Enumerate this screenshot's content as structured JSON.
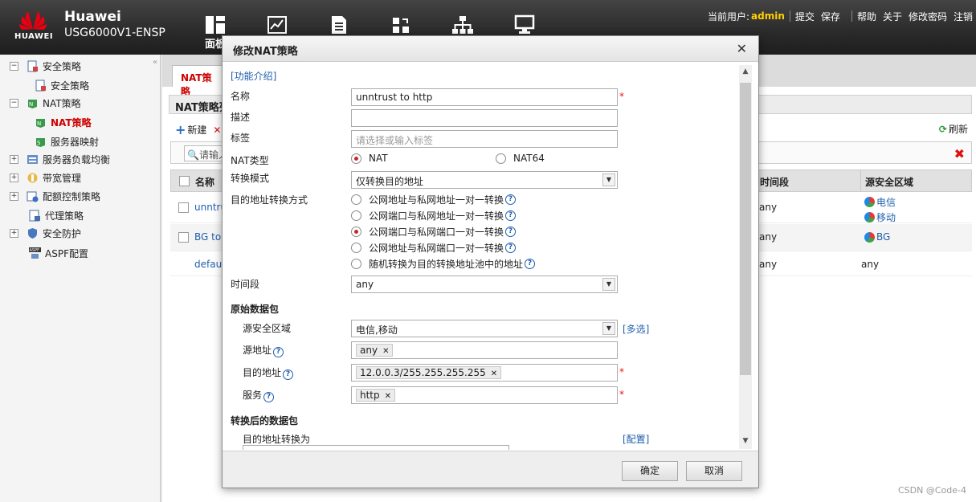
{
  "header": {
    "logo_text": "HUAWEI",
    "brand": "Huawei",
    "model": "USG6000V1-ENSP",
    "nav_label": "面板",
    "current_user_label": "当前用户:",
    "current_user": "admin",
    "links": [
      "提交",
      "保存",
      "帮助",
      "关于",
      "修改密码",
      "注销"
    ]
  },
  "sidebar": {
    "items": [
      {
        "label": "安全策略",
        "expander": "−",
        "icon": "security-policy-icon"
      },
      {
        "label": "安全策略",
        "icon": "security-policy-leaf-icon"
      },
      {
        "label": "NAT策略",
        "expander": "−",
        "icon": "nat-policy-icon"
      },
      {
        "label": "NAT策略",
        "icon": "nat-policy-leaf-icon",
        "active": true
      },
      {
        "label": "服务器映射",
        "icon": "server-mapping-icon"
      },
      {
        "label": "服务器负载均衡",
        "expander": "+",
        "icon": "load-balance-icon"
      },
      {
        "label": "带宽管理",
        "expander": "+",
        "icon": "bandwidth-icon"
      },
      {
        "label": "配额控制策略",
        "expander": "+",
        "icon": "quota-icon"
      },
      {
        "label": "代理策略",
        "icon": "proxy-icon"
      },
      {
        "label": "安全防护",
        "expander": "+",
        "icon": "shield-icon"
      },
      {
        "label": "ASPF配置",
        "icon": "aspf-icon"
      }
    ]
  },
  "main": {
    "tab": "NAT策略",
    "panel_title": "NAT策略列",
    "new_label": "新建",
    "refresh_label": "刷新",
    "search_placeholder": "请输入",
    "columns": {
      "name": "名称",
      "time": "时间段",
      "src_zone": "源安全区域"
    },
    "rows": [
      {
        "name": "unntru",
        "time": "any",
        "zones": [
          "电信",
          "移动"
        ]
      },
      {
        "name": "BG to",
        "time": "any",
        "zones": [
          "BG"
        ]
      },
      {
        "name": "default",
        "time": "any",
        "zones_text": "any"
      }
    ]
  },
  "dialog": {
    "title": "修改NAT策略",
    "help_link": "[功能介绍]",
    "name_label": "名称",
    "name_value": "unntrust to http",
    "desc_label": "描述",
    "desc_value": "",
    "tag_label": "标签",
    "tag_placeholder": "请选择或输入标签",
    "nat_type_label": "NAT类型",
    "nat_type_options": [
      "NAT",
      "NAT64"
    ],
    "nat_type_selected": "NAT",
    "mode_label": "转换模式",
    "mode_value": "仅转换目的地址",
    "dst_method_label": "目的地址转换方式",
    "dst_methods": [
      "公网地址与私网地址一对一转换",
      "公网端口与私网地址一对一转换",
      "公网端口与私网端口一对一转换",
      "公网地址与私网端口一对一转换",
      "随机转换为目的转换地址池中的地址"
    ],
    "dst_method_selected": 2,
    "time_label": "时间段",
    "time_value": "any",
    "orig_section": "原始数据包",
    "src_zone_label": "源安全区域",
    "src_zone_value": "电信,移动",
    "multi_select": "[多选]",
    "src_addr_label": "源地址",
    "src_addr_tag": "any",
    "dst_addr_label": "目的地址",
    "dst_addr_tag": "12.0.0.3/255.255.255.255",
    "service_label": "服务",
    "service_tag": "http",
    "after_section": "转换后的数据包",
    "dst_convert_label": "目的地址转换为",
    "config_link": "[配置]",
    "ok_label": "确定",
    "cancel_label": "取消"
  },
  "footer": {
    "watermark": "CSDN @Code-4"
  },
  "colors": {
    "accent_red": "#c00000",
    "link_blue": "#1f5fad",
    "user_yellow": "#ffd100",
    "topbar": "#2f2f2f"
  }
}
